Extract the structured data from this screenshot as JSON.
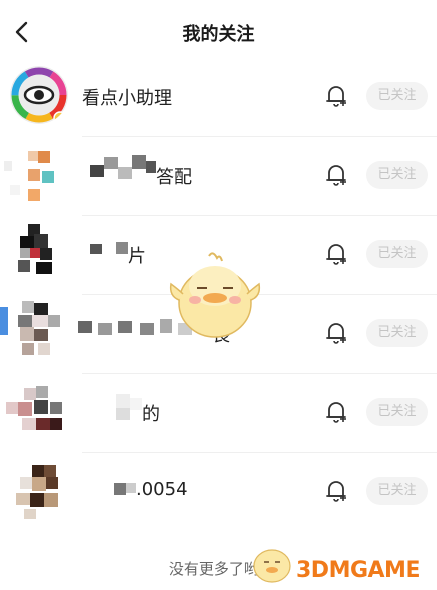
{
  "header": {
    "title": "我的关注"
  },
  "follow_list": [
    {
      "name": "看点小助理",
      "button": "已关注"
    },
    {
      "name": "答配",
      "button": "已关注"
    },
    {
      "name": "片",
      "button": "已关注"
    },
    {
      "name": "長",
      "button": "已关注"
    },
    {
      "name": "的",
      "button": "已关注"
    },
    {
      "name": ".0054",
      "button": "已关注"
    }
  ],
  "footer": {
    "text": "没有更多了哟o"
  },
  "watermark": {
    "text": "3DMGAME"
  },
  "icons": [
    "back-arrow-icon",
    "bell-plus-icon",
    "eye-logo-icon",
    "mascot-chick-icon"
  ]
}
